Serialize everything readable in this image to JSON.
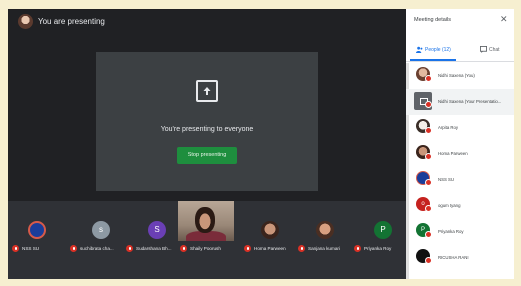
{
  "meeting": {
    "presenting_title": "You are presenting",
    "present_message": "You're presenting to everyone",
    "stop_label": "Stop presenting"
  },
  "strip": {
    "tiles": [
      {
        "name": "NSS SU",
        "initial": "",
        "color": "#1a3d9a"
      },
      {
        "name": "suchibrata cha...",
        "initial": "s",
        "color": "#8d99a3"
      },
      {
        "name": "Sudarshana Bh...",
        "initial": "S",
        "color": "#6a3fb5"
      },
      {
        "name": "Shaily Poorush",
        "initial": "",
        "color": "#9a8878"
      },
      {
        "name": "Homa Parween",
        "initial": "",
        "color": "#c9967a"
      },
      {
        "name": "Sanjana kumari",
        "initial": "",
        "color": "#c97a5a"
      },
      {
        "name": "Priyanka Roy",
        "initial": "P",
        "color": "#137333"
      }
    ]
  },
  "panel": {
    "title": "Meeting details",
    "tab_people": "People (12)",
    "tab_chat": "Chat",
    "people": [
      {
        "name": "Nidhi Saxena (You)",
        "initial": "",
        "color": "#b0806a"
      },
      {
        "name": "Nidhi Saxena (Your Presentatio...",
        "initial": "",
        "color": "#5f6368"
      },
      {
        "name": "Arpita Roy",
        "initial": "",
        "color": "#e8e0d8"
      },
      {
        "name": "Homa Parween",
        "initial": "",
        "color": "#c9967a"
      },
      {
        "name": "NSS SU",
        "initial": "",
        "color": "#1a3d9a"
      },
      {
        "name": "ogum tyang",
        "initial": "o",
        "color": "#c5221f"
      },
      {
        "name": "Priyanka Roy",
        "initial": "P",
        "color": "#137333"
      },
      {
        "name": "RICUSHA RANI",
        "initial": "",
        "color": "#111111"
      }
    ]
  },
  "colors": {
    "accent": "#1a73e8",
    "stop_button": "#1e8e3e",
    "mic_muted": "#d93025"
  }
}
